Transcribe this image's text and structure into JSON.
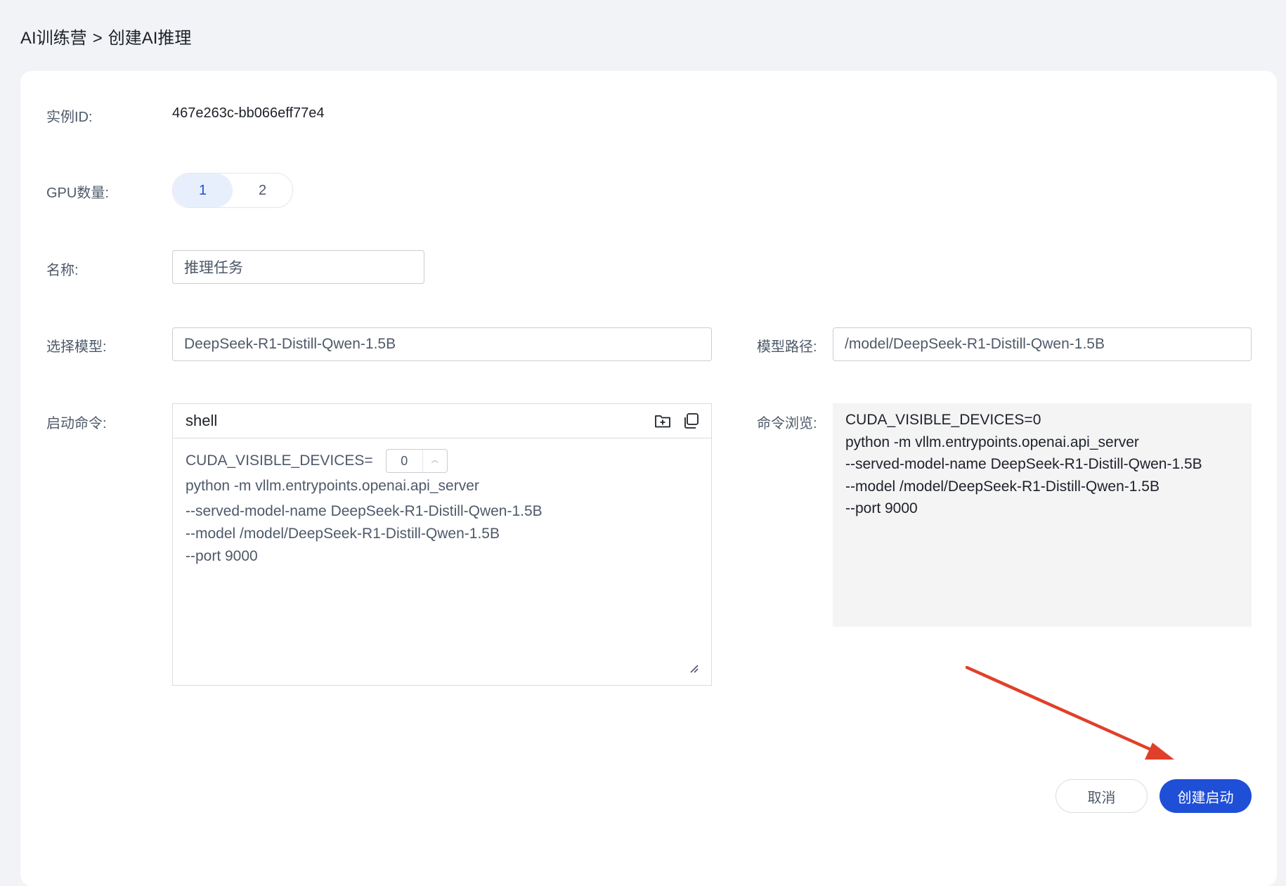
{
  "breadcrumb": {
    "parent": "AI训练营",
    "separator": ">",
    "current": "创建AI推理"
  },
  "form": {
    "instance_id_label": "实例ID:",
    "instance_id": "467e263c-bb066eff77e4",
    "gpu_label": "GPU数量:",
    "gpu_options": [
      "1",
      "2"
    ],
    "gpu_selected": "1",
    "name_label": "名称:",
    "name_value": "推理任务",
    "model_label": "选择模型:",
    "model_value": "DeepSeek-R1-Distill-Qwen-1.5B",
    "model_path_label": "模型路径:",
    "model_path_value": "/model/DeepSeek-R1-Distill-Qwen-1.5B",
    "command_label": "启动命令:",
    "preview_label": "命令浏览:"
  },
  "editor": {
    "title": "shell",
    "icons": [
      "folder-add-icon",
      "copy-icon"
    ],
    "env_prefix": "CUDA_VISIBLE_DEVICES=",
    "device_value": "0",
    "lines": [
      "python -m vllm.entrypoints.openai.api_server",
      "--served-model-name DeepSeek-R1-Distill-Qwen-1.5B",
      "--model /model/DeepSeek-R1-Distill-Qwen-1.5B",
      "--port 9000"
    ]
  },
  "preview": {
    "lines": [
      "CUDA_VISIBLE_DEVICES=0",
      "python -m vllm.entrypoints.openai.api_server",
      "--served-model-name DeepSeek-R1-Distill-Qwen-1.5B",
      "--model /model/DeepSeek-R1-Distill-Qwen-1.5B",
      "--port 9000"
    ]
  },
  "buttons": {
    "cancel": "取消",
    "submit": "创建启动"
  },
  "colors": {
    "primary": "#1f4fd6",
    "annotation_arrow": "#e0402a",
    "segment_active_bg": "#e8effc"
  }
}
